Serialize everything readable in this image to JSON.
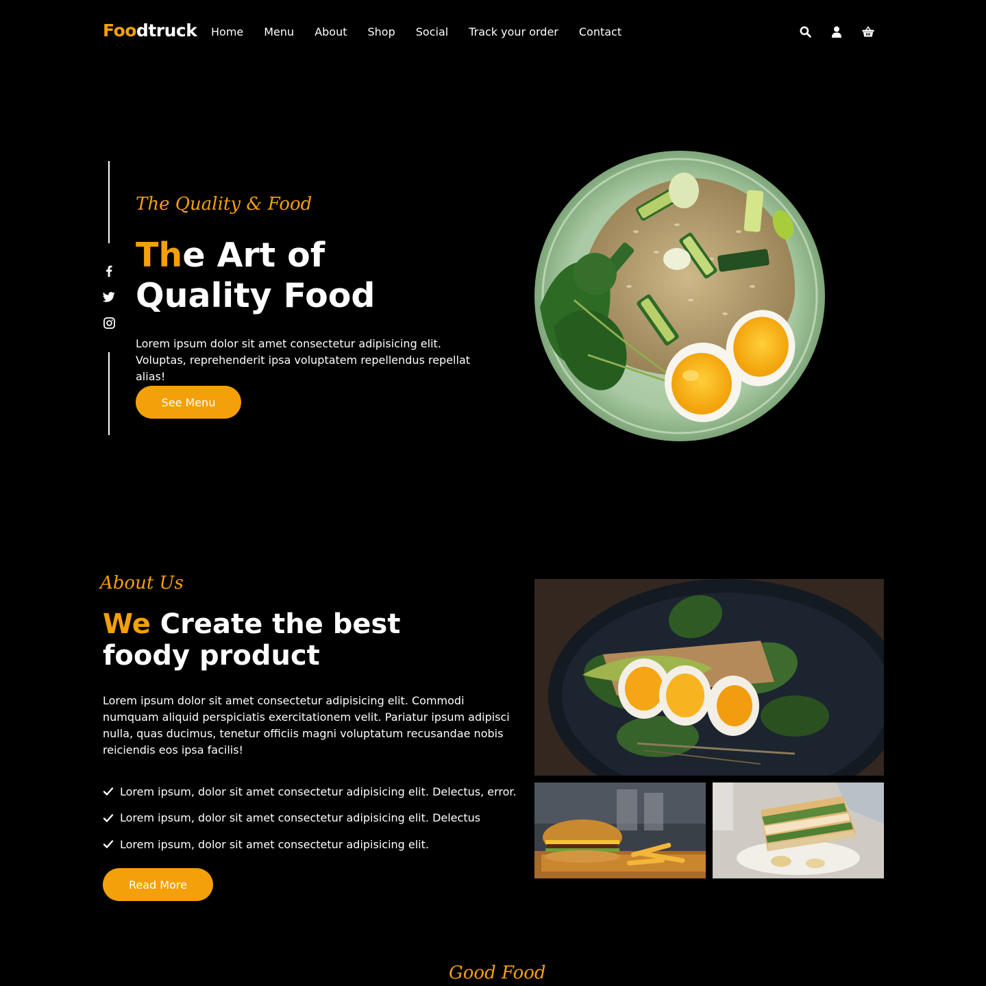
{
  "header": {
    "logo_accent": "Foo",
    "logo_rest": "dtruck",
    "nav": [
      "Home",
      "Menu",
      "About",
      "Shop",
      "Social",
      "Track your order",
      "Contact"
    ],
    "icons": [
      "search-icon",
      "user-icon",
      "cart-icon"
    ]
  },
  "hero": {
    "subtitle": "The Quality & Food",
    "title_accent": "Th",
    "title_rest_line1": "e Art of",
    "title_line2": "Quality Food",
    "description": "Lorem ipsum dolor sit amet consectetur adipisicing elit. Voluptas, reprehenderit ipsa voluptatem repellendus repellat alias!",
    "button": "See Menu",
    "social_icons": [
      "facebook-icon",
      "twitter-icon",
      "instagram-icon"
    ]
  },
  "about": {
    "subtitle": "About Us",
    "title_accent": "We",
    "title_rest_line1": " Create the best",
    "title_line2": "foody product",
    "description": "Lorem ipsum dolor sit amet consectetur adipisicing elit. Commodi numquam aliquid perspiciatis exercitationem velit. Pariatur ipsum adipisci nulla, quas ducimus, tenetur officiis magni voluptatum recusandae nobis reiciendis eos ipsa facilis!",
    "checklist": [
      "Lorem ipsum, dolor sit amet consectetur adipisicing elit. Delectus, error.",
      "Lorem ipsum, dolor sit amet consectetur adipisicing elit. Delectus",
      "Lorem ipsum, dolor sit amet consectetur adipisicing elit."
    ],
    "button": "Read More"
  },
  "next_section": {
    "subtitle": "Good Food"
  },
  "colors": {
    "accent": "#f4a00b",
    "background": "#000000",
    "text": "#ffffff"
  }
}
